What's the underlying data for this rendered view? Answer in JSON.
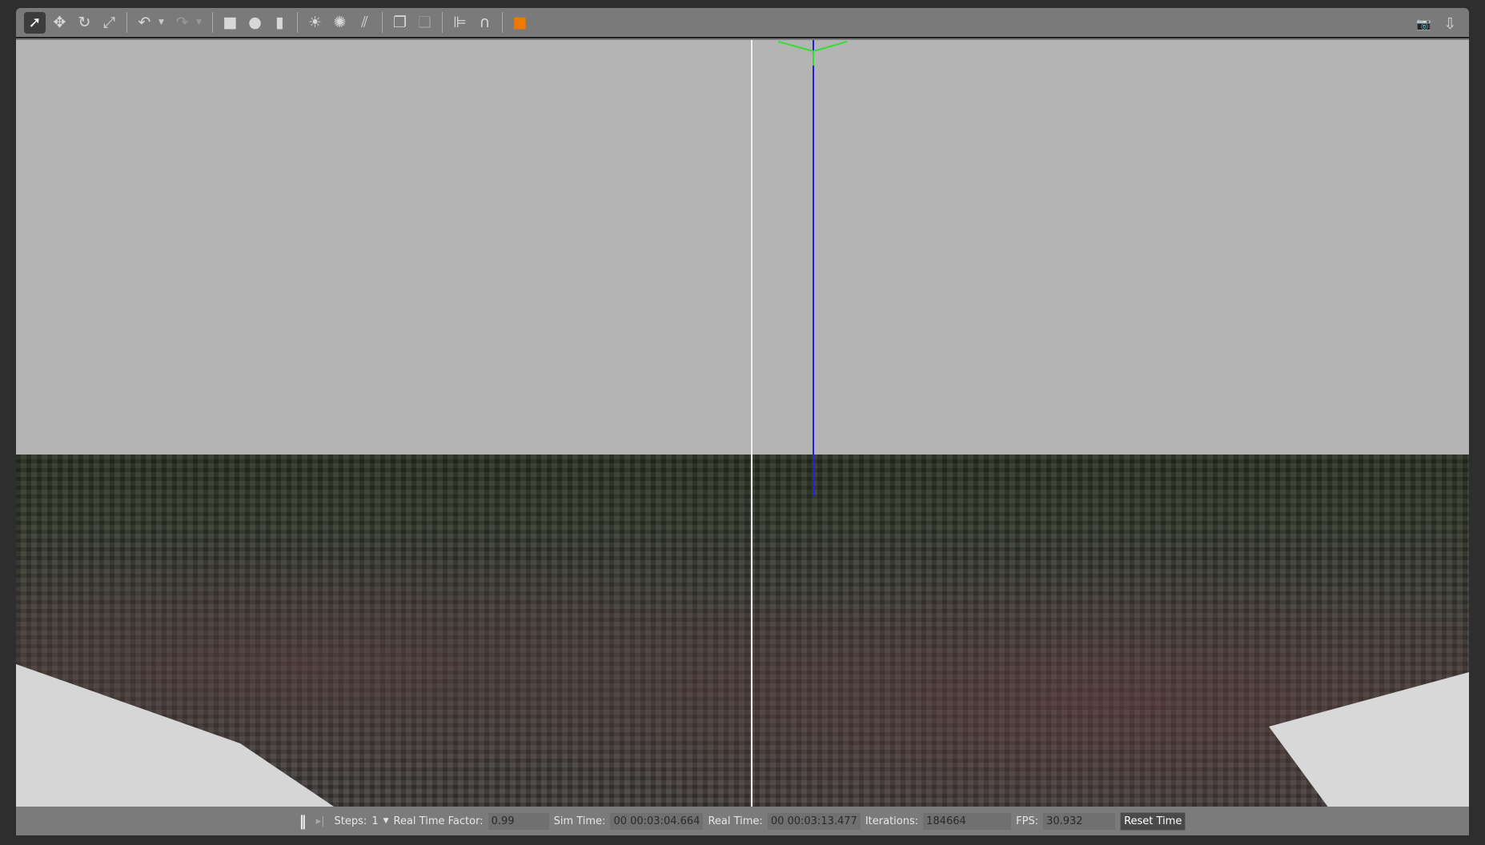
{
  "toolbar": {
    "tools": [
      {
        "name": "select-mode",
        "glyph": "➚"
      },
      {
        "name": "translate-mode",
        "glyph": "✥"
      },
      {
        "name": "rotate-mode",
        "glyph": "↻"
      },
      {
        "name": "scale-mode",
        "glyph": "⤢"
      },
      {
        "name": "undo",
        "glyph": "↶"
      },
      {
        "name": "redo",
        "glyph": "↷"
      },
      {
        "name": "box-shape",
        "glyph": "■"
      },
      {
        "name": "sphere-shape",
        "glyph": "●"
      },
      {
        "name": "cylinder-shape",
        "glyph": "▮"
      },
      {
        "name": "point-light",
        "glyph": "☀"
      },
      {
        "name": "spot-light",
        "glyph": "✺"
      },
      {
        "name": "directional-light",
        "glyph": "⫽"
      },
      {
        "name": "copy",
        "glyph": "❐"
      },
      {
        "name": "paste",
        "glyph": "❏"
      },
      {
        "name": "align",
        "glyph": "⊫"
      },
      {
        "name": "snap",
        "glyph": "∩"
      },
      {
        "name": "view-angle",
        "glyph": "■"
      },
      {
        "name": "screenshot",
        "glyph": "📷"
      },
      {
        "name": "log",
        "glyph": "⇩"
      }
    ],
    "accent": "#f07800"
  },
  "bottom": {
    "steps_label": "Steps:",
    "steps_value": "1",
    "rtf_label": "Real Time Factor:",
    "rtf_value": "0.99",
    "sim_label": "Sim Time:",
    "sim_value": "00 00:03:04.664",
    "real_label": "Real Time:",
    "real_value": "00 00:03:13.477",
    "iter_label": "Iterations:",
    "iter_value": "184664",
    "fps_label": "FPS:",
    "fps_value": "30.932",
    "reset_label": "Reset Time"
  }
}
